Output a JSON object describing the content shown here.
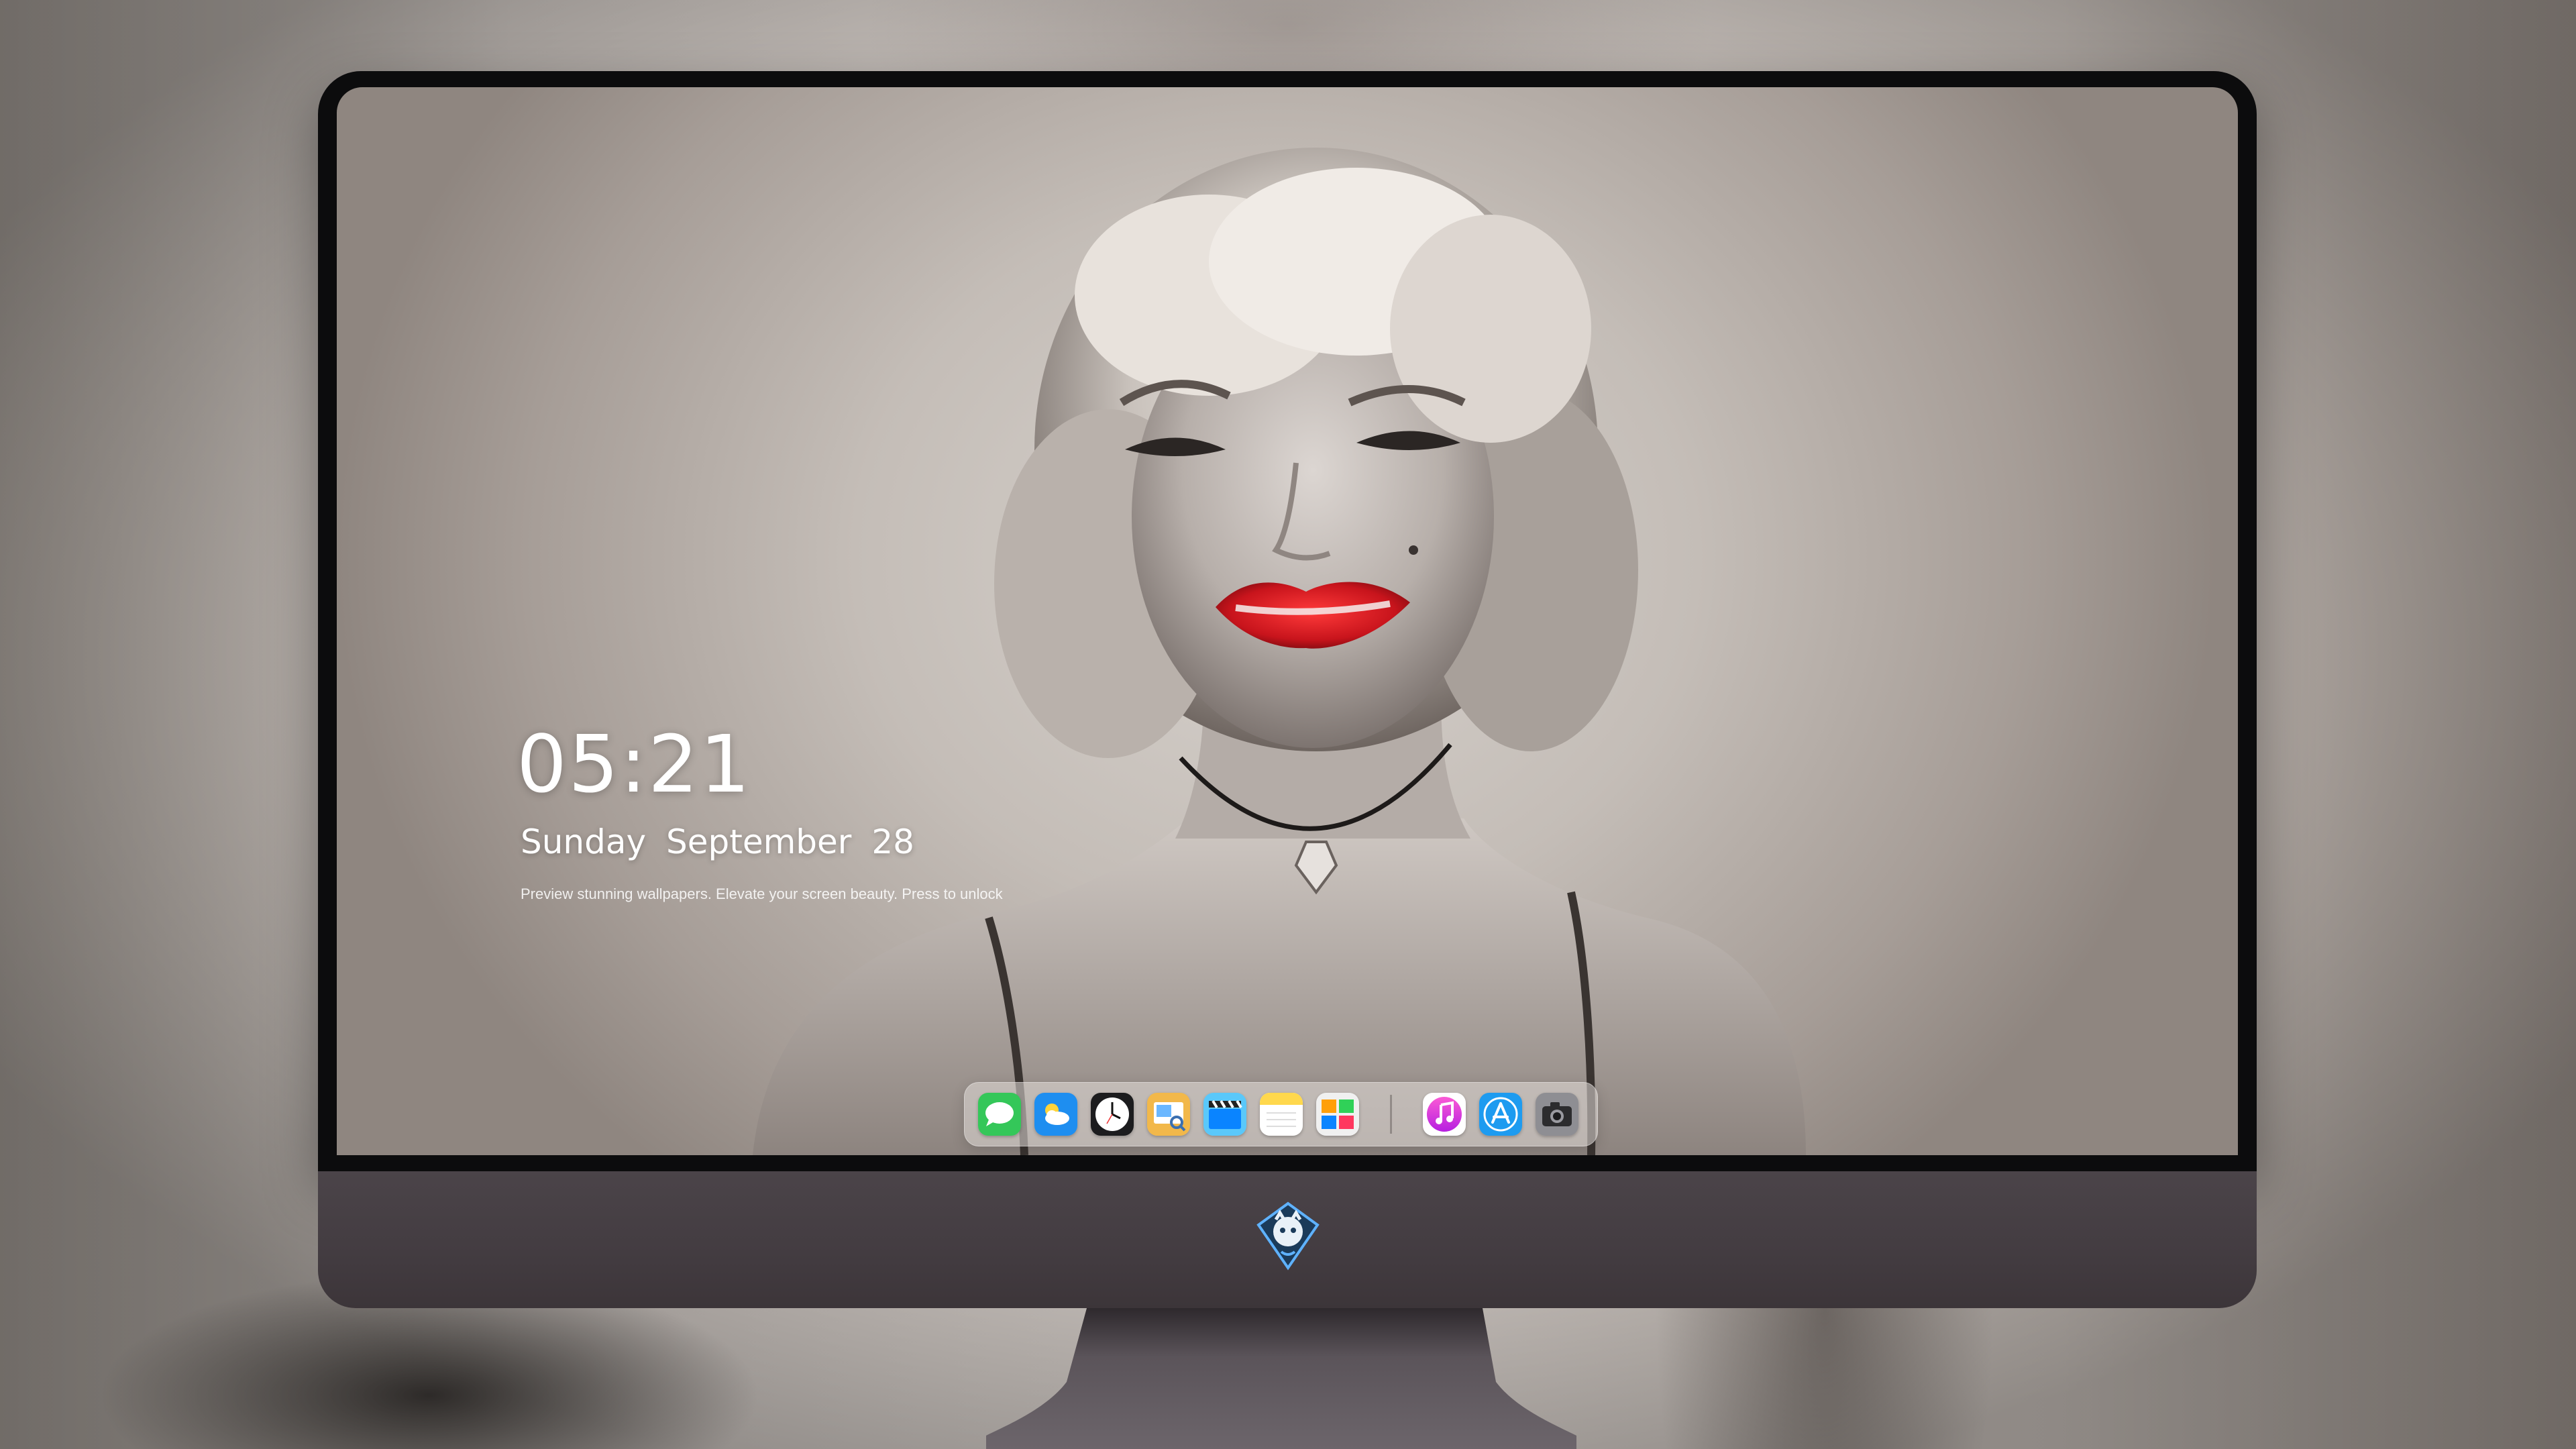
{
  "lock_screen": {
    "time": "05:21",
    "weekday": "Sunday",
    "month": "September",
    "day": "28",
    "tagline": "Preview stunning wallpapers. Elevate your screen beauty. Press to unlock"
  },
  "dock": {
    "apps": [
      {
        "name": "Messages",
        "icon": "messages-icon",
        "color": "#34c759"
      },
      {
        "name": "Weather",
        "icon": "weather-icon",
        "color": "#1e8ef0"
      },
      {
        "name": "Clock",
        "icon": "clock-icon",
        "color": "#1c1c1e"
      },
      {
        "name": "Preview",
        "icon": "preview-icon",
        "color": "#f2b84a"
      },
      {
        "name": "Clips",
        "icon": "clapperboard-icon",
        "color": "#5ac8fa"
      },
      {
        "name": "Notes",
        "icon": "notes-icon",
        "color": "#ffd84d"
      },
      {
        "name": "Photo Booth",
        "icon": "photo-gallery-icon",
        "color": "#f0f0f0"
      },
      {
        "name": "iTunes",
        "icon": "music-note-icon",
        "color": "#e83ad1"
      },
      {
        "name": "App Store",
        "icon": "app-store-icon",
        "color": "#1d9bf0"
      },
      {
        "name": "Camera",
        "icon": "camera-icon",
        "color": "#8e8e93"
      }
    ]
  },
  "colors": {
    "lipstick": "#c8141c",
    "bezel": "#0c0c0d",
    "chin": "#463f44"
  }
}
